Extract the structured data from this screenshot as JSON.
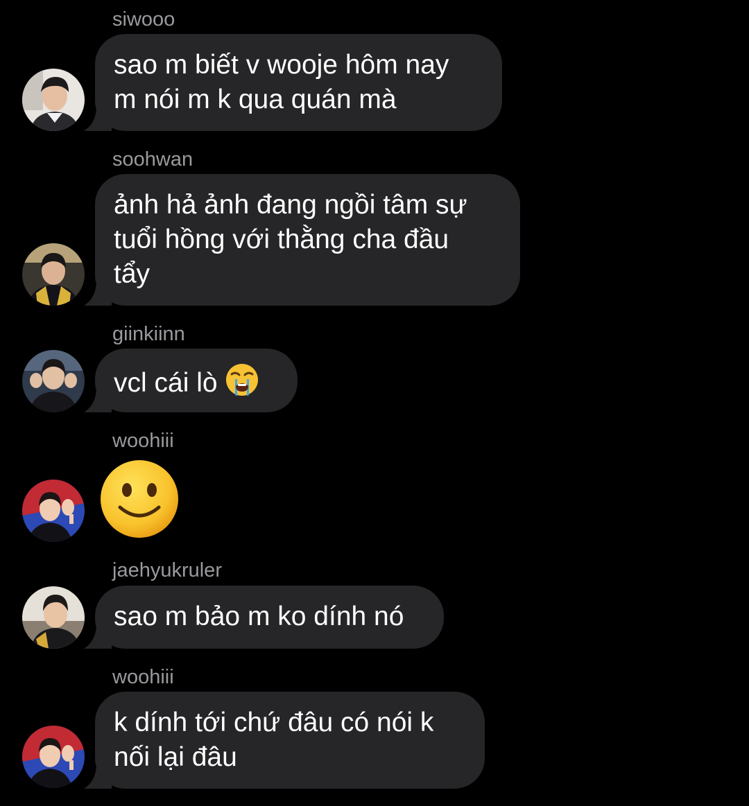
{
  "thread": {
    "messages": [
      {
        "sender": "siwooo",
        "lines": [
          "sao m biết v wooje hôm nay",
          "m nói m k qua quán mà"
        ]
      },
      {
        "sender": "soohwan",
        "lines": [
          "ảnh hả ảnh đang ngồi tâm sự",
          "tuổi hồng với thằng cha đầu",
          "tẩy"
        ]
      },
      {
        "sender": "giinkiinn",
        "text": "vcl cái lò",
        "emoji": "loudly-crying-face"
      },
      {
        "sender": "woohiii",
        "emoji": "slightly-smiling-face"
      },
      {
        "sender": "jaehyukruler",
        "text": "sao m bảo m ko dính nó"
      },
      {
        "sender": "woohiii",
        "lines": [
          "k dính tới chứ đâu có nói k",
          "nối lại đâu"
        ]
      }
    ]
  },
  "colors": {
    "background": "#000000",
    "bubble": "#262628",
    "sender_label": "#9a9a9e",
    "message_text": "#ffffff"
  }
}
